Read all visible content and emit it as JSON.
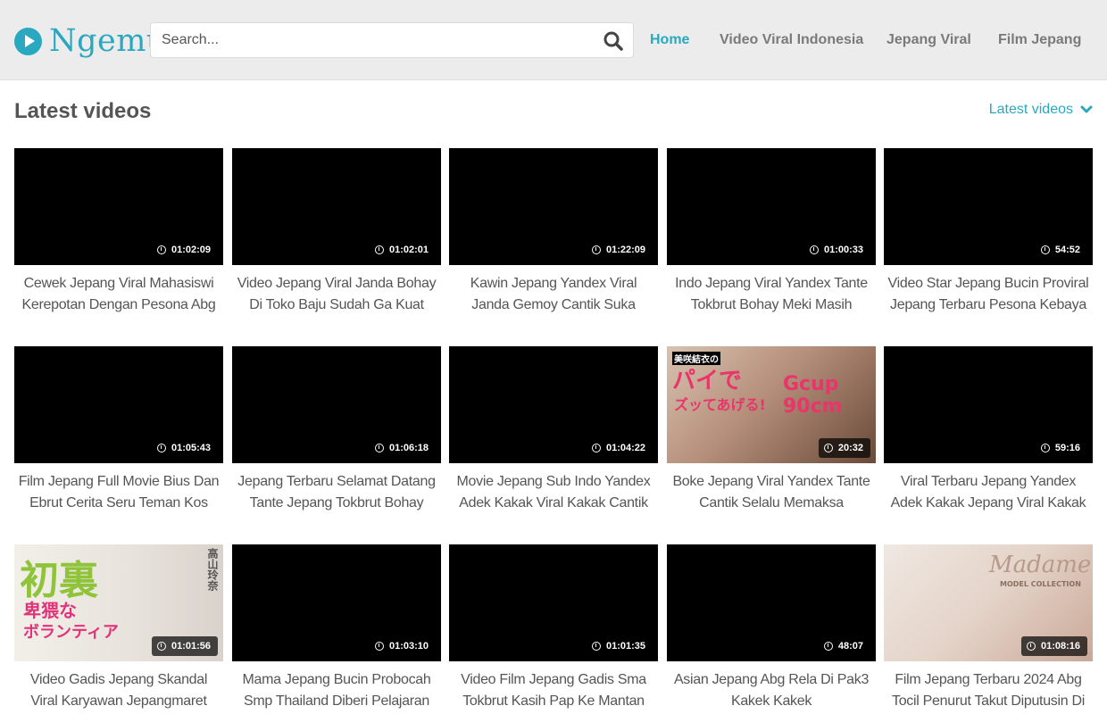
{
  "header": {
    "logo_text": "Ngemut",
    "search_placeholder": "Search...",
    "nav": [
      {
        "label": "Home",
        "active": true
      },
      {
        "label": "Video Viral Indonesia",
        "active": false
      },
      {
        "label": "Jepang Viral",
        "active": false
      },
      {
        "label": "Film Jepang",
        "active": false
      }
    ]
  },
  "main": {
    "section_title": "Latest videos",
    "sort_label": "Latest videos",
    "videos": [
      {
        "duration": "01:02:09",
        "title": "Cewek Jepang Viral Mahasiswi Kerepotan Dengan Pesona Abg"
      },
      {
        "duration": "01:02:01",
        "title": "Video Jepang Viral Janda Bohay Di Toko Baju Sudah Ga Kuat Ingin"
      },
      {
        "duration": "01:22:09",
        "title": "Kawin Jepang Yandex Viral Janda Gemoy Cantik Suka Mainin Otong"
      },
      {
        "duration": "01:00:33",
        "title": "Indo Jepang Viral Yandex Tante Tokbrut Bohay Meki Masih Sempit"
      },
      {
        "duration": "54:52",
        "title": "Video Star Jepang Bucin Proviral Jepang Terbaru Pesona Kebaya"
      },
      {
        "duration": "01:05:43",
        "title": "Film Jepang Full Movie Bius Dan Ebrut Cerita Seru Teman Kos"
      },
      {
        "duration": "01:06:18",
        "title": "Jepang Terbaru Selamat Datang Tante Jepang Tokbrut Bohay"
      },
      {
        "duration": "01:04:22",
        "title": "Movie Jepang Sub Indo Yandex Adek Kakak Viral Kakak Cantik"
      },
      {
        "duration": "20:32",
        "title": "Boke Jepang Viral Yandex Tante Cantik Selalu Memaksa",
        "thumb_text": [
          "美咲結衣の",
          "パイで",
          "ズッてあげる!",
          "Gcup 90cm"
        ]
      },
      {
        "duration": "59:16",
        "title": "Viral Terbaru Jepang Yandex Adek Kakak Jepang Viral Kakak Paksa"
      },
      {
        "duration": "01:01:56",
        "title": "Video Gadis Jepang Skandal Viral Karyawan Jepangmaret Cerita",
        "thumb_text": [
          "初裏",
          "卑猥な",
          "ボランティア",
          "高山玲奈"
        ]
      },
      {
        "duration": "01:03:10",
        "title": "Mama Jepang Bucin Probocah Smp Thailand Diberi Pelajaran"
      },
      {
        "duration": "01:01:35",
        "title": "Video Film Jepang Gadis Sma Tokbrut Kasih Pap Ke Mantan Biar"
      },
      {
        "duration": "48:07",
        "title": "Asian Jepang Abg Rela Di Pak3 Kakek Kakek"
      },
      {
        "duration": "01:08:16",
        "title": "Film Jepang Terbaru 2024 Abg Tocil Penurut Takut Diputusin Di",
        "thumb_text": [
          "Madame",
          "MODEL COLLECTION"
        ]
      }
    ]
  },
  "colors": {
    "accent": "#2aa8c0",
    "header_bg": "#ececec",
    "text": "#555555"
  }
}
